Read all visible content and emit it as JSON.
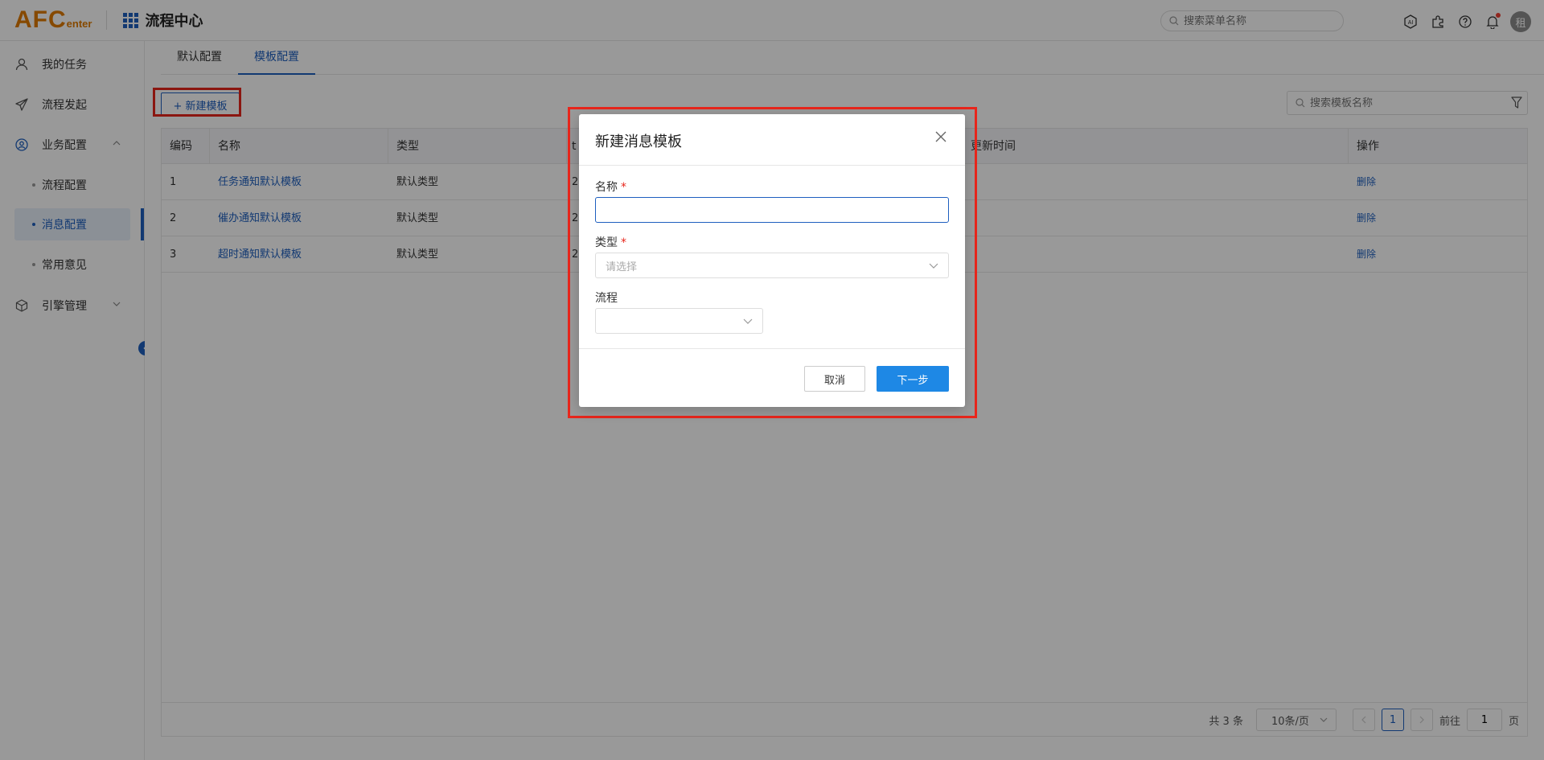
{
  "header": {
    "logo_main": "AFC",
    "logo_sub": "enter",
    "app_title": "流程中心",
    "menu_search_placeholder": "搜索菜单名称",
    "avatar_text": "租",
    "icons": [
      "ai-icon",
      "plugin-icon",
      "help-icon",
      "bell-icon"
    ]
  },
  "sidebar": {
    "items": [
      {
        "label": "我的任务",
        "icon": "user-icon"
      },
      {
        "label": "流程发起",
        "icon": "send-icon"
      },
      {
        "label": "业务配置",
        "icon": "config-icon",
        "expanded": true
      },
      {
        "label": "引擎管理",
        "icon": "cube-icon",
        "expanded": false
      }
    ],
    "sub_items": [
      {
        "label": "流程配置"
      },
      {
        "label": "消息配置",
        "active": true
      },
      {
        "label": "常用意见"
      }
    ]
  },
  "main": {
    "tabs": [
      {
        "label": "默认配置",
        "active": false
      },
      {
        "label": "模板配置",
        "active": true
      }
    ],
    "new_button_label": "+ 新建模板",
    "template_search_placeholder": "搜索模板名称",
    "table": {
      "columns": [
        "编码",
        "名称",
        "类型",
        "t",
        "更新时间",
        "操作"
      ],
      "rows": [
        {
          "code": "1",
          "name": "任务通知默认模板",
          "type": "默认类型",
          "partial": "2",
          "action": "删除"
        },
        {
          "code": "2",
          "name": "催办通知默认模板",
          "type": "默认类型",
          "partial": "2",
          "action": "删除"
        },
        {
          "code": "3",
          "name": "超时通知默认模板",
          "type": "默认类型",
          "partial": "2",
          "action": "删除"
        }
      ]
    },
    "pagination": {
      "total_text": "共 3 条",
      "page_size": "10条/页",
      "current_page": "1",
      "goto_label": "前往",
      "goto_value": "1",
      "page_suffix": "页"
    }
  },
  "modal": {
    "title": "新建消息模板",
    "name_label": "名称",
    "name_required": "*",
    "name_value": "",
    "type_label": "类型",
    "type_required": "*",
    "type_placeholder": "请选择",
    "flow_label": "流程",
    "flow_value": "",
    "cancel_label": "取消",
    "next_label": "下一步"
  },
  "colors": {
    "primary": "#1e5fbf",
    "button_primary": "#1e88e5",
    "highlight": "#e8261c",
    "logo": "#e07b00"
  }
}
